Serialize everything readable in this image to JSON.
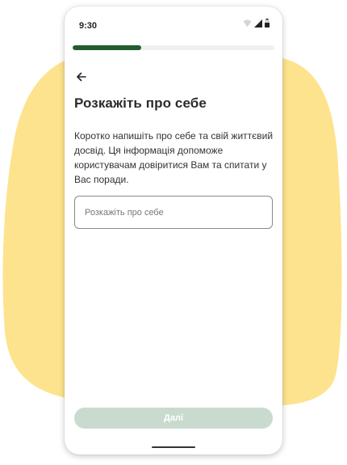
{
  "colors": {
    "blob": "#fde38e",
    "accent": "#215e2e",
    "button_disabled": "#c9dbcf",
    "text_primary": "#2b2b2b"
  },
  "status_bar": {
    "time": "9:30",
    "icons": [
      "wifi-icon",
      "signal-icon",
      "battery-icon"
    ]
  },
  "progress": {
    "fraction": 0.34
  },
  "header": {
    "back_icon": "arrow-left-icon",
    "title": "Розкажіть про себе"
  },
  "main": {
    "description": "Коротко напишіть про себе та свій життєвий досвід. Ця інформація допоможе користувачам довіритися Вам та спитати у Вас поради.",
    "input": {
      "placeholder": "Розкажіть про себе",
      "value": ""
    }
  },
  "footer": {
    "next_label": "Далі"
  }
}
